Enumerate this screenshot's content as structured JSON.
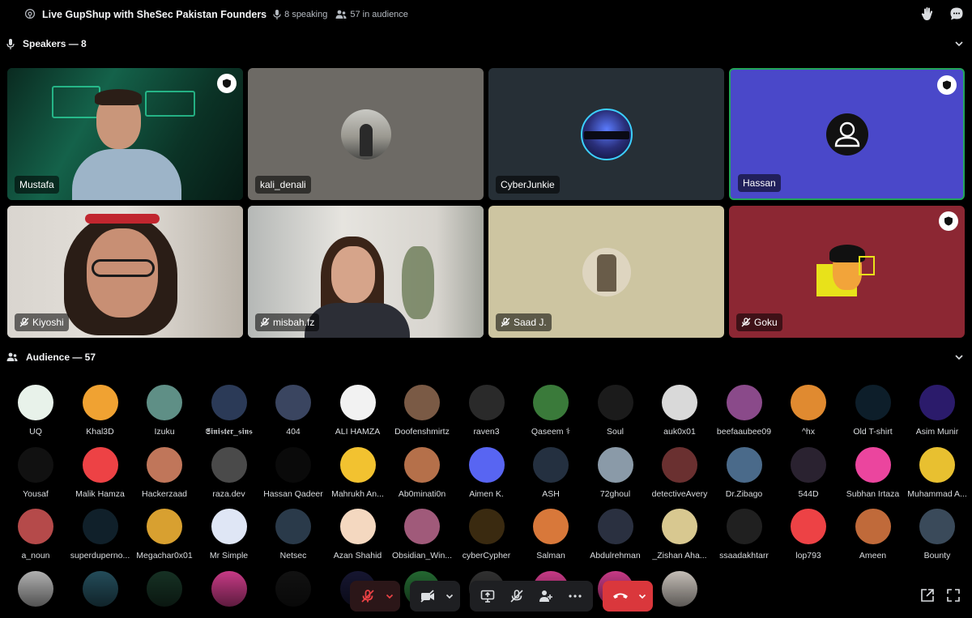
{
  "stage": {
    "title": "Live GupShup with SheSec Pakistan Founders",
    "speaking": "8 speaking",
    "audience_count": "57 in audience"
  },
  "speakers_section": {
    "label": "Speakers — 8"
  },
  "audience_section": {
    "label": "Audience — 57"
  },
  "speakers": [
    {
      "name": "Mustafa",
      "muted": false,
      "bg": "#0f3b2c",
      "moderator": true
    },
    {
      "name": "kali_denali",
      "muted": false,
      "bg": "#6d6a65",
      "moderator": false
    },
    {
      "name": "CyberJunkie",
      "muted": false,
      "bg": "#262f36",
      "moderator": false
    },
    {
      "name": "Hassan",
      "muted": false,
      "bg": "#4a48c9",
      "moderator": true
    },
    {
      "name": "Kiyoshi",
      "muted": true,
      "bg": "#c9c0b8",
      "moderator": false
    },
    {
      "name": "misbah.fz",
      "muted": true,
      "bg": "#d3d1cc",
      "moderator": false
    },
    {
      "name": "Saad J.",
      "muted": true,
      "bg": "#cdc5a1",
      "moderator": false
    },
    {
      "name": "Goku",
      "muted": true,
      "bg": "#8c2733",
      "moderator": true
    }
  ],
  "audience": [
    {
      "name": "UQ",
      "color": "#e8f2ea"
    },
    {
      "name": "Khal3D",
      "color": "#f0a232"
    },
    {
      "name": "Izuku",
      "color": "#5f8f86"
    },
    {
      "name": "𝕾𝖎𝖓𝖎𝖘𝖙𝖊𝖗_𝖘𝖎𝖓𝖘",
      "color": "#2b3a57"
    },
    {
      "name": "404",
      "color": "#3a4560"
    },
    {
      "name": "ALI HAMZA",
      "color": "#f2f2f2"
    },
    {
      "name": "Doofenshmirtz",
      "color": "#7a5a45"
    },
    {
      "name": "raven3",
      "color": "#2a2a2a"
    },
    {
      "name": "Qaseem ⚕",
      "color": "#3a7a3a"
    },
    {
      "name": "Soul",
      "color": "#1b1b1b"
    },
    {
      "name": "auk0x01",
      "color": "#d9d9d9"
    },
    {
      "name": "beefaaubee09",
      "color": "#8a4a8a"
    },
    {
      "name": "^hx",
      "color": "#e08a30"
    },
    {
      "name": "Old T-shirt",
      "color": "#0d1e2a"
    },
    {
      "name": "Asim Munir",
      "color": "#2b1b6b"
    },
    {
      "name": "Yousaf",
      "color": "#111111"
    },
    {
      "name": "Malik Hamza",
      "color": "#ed4245"
    },
    {
      "name": "Hackerzaad",
      "color": "#c0765a"
    },
    {
      "name": "raza.dev",
      "color": "#4a4a4a"
    },
    {
      "name": "Hassan Qadeer",
      "color": "#0a0a0a"
    },
    {
      "name": "Mahrukh An...",
      "color": "#f2c230"
    },
    {
      "name": "Ab0minati0n",
      "color": "#b5704a"
    },
    {
      "name": "Aimen K.",
      "color": "#5865f2"
    },
    {
      "name": "ASH",
      "color": "#243040"
    },
    {
      "name": "72ghoul",
      "color": "#8a9aa8"
    },
    {
      "name": "detectiveAvery",
      "color": "#6a3030"
    },
    {
      "name": "Dr.Zibago",
      "color": "#4a6a8a"
    },
    {
      "name": "544D",
      "color": "#2a2230"
    },
    {
      "name": "Subhan Irtaza",
      "color": "#eb459e"
    },
    {
      "name": "Muhammad A...",
      "color": "#e8c030"
    },
    {
      "name": "a_noun",
      "color": "#b54a4a"
    },
    {
      "name": "superduperno...",
      "color": "#10202a"
    },
    {
      "name": "Megachar0x01",
      "color": "#d8a030"
    },
    {
      "name": "Mr Simple",
      "color": "#dfe6f5"
    },
    {
      "name": "Netsec",
      "color": "#2a3a4a"
    },
    {
      "name": "Azan Shahid",
      "color": "#f4d8c0"
    },
    {
      "name": "Obsidian_Win...",
      "color": "#a05a7a"
    },
    {
      "name": "cyberCypher",
      "color": "#3a2a10"
    },
    {
      "name": "Salman",
      "color": "#d8783a"
    },
    {
      "name": "Abdulrehman",
      "color": "#2a3040"
    },
    {
      "name": "_Zishan Aha...",
      "color": "#d8c890"
    },
    {
      "name": "ssaadakhtarr",
      "color": "#202020"
    },
    {
      "name": "lop793",
      "color": "#ed4245"
    },
    {
      "name": "Ameen",
      "color": "#c06a3a"
    },
    {
      "name": "Bounty",
      "color": "#3a4a5a"
    }
  ],
  "audience_partial": [
    {
      "color": "#d0d0d0"
    },
    {
      "color": "#2a5a6a"
    },
    {
      "color": "#1a3a2a"
    },
    {
      "color": "#eb459e"
    },
    {
      "color": "#151515"
    },
    {
      "color": "#1a1a3a"
    },
    {
      "color": "#2a7a3a"
    },
    {
      "color": "#3a3a3a"
    },
    {
      "color": "#eb459e"
    },
    {
      "color": "#eb459e"
    },
    {
      "color": "#e8e0d8"
    }
  ],
  "colors": {
    "background": "#000000",
    "tile_selected_border": "#23a55a",
    "leave_red": "#da373c",
    "muted_red": "#ed4245"
  }
}
